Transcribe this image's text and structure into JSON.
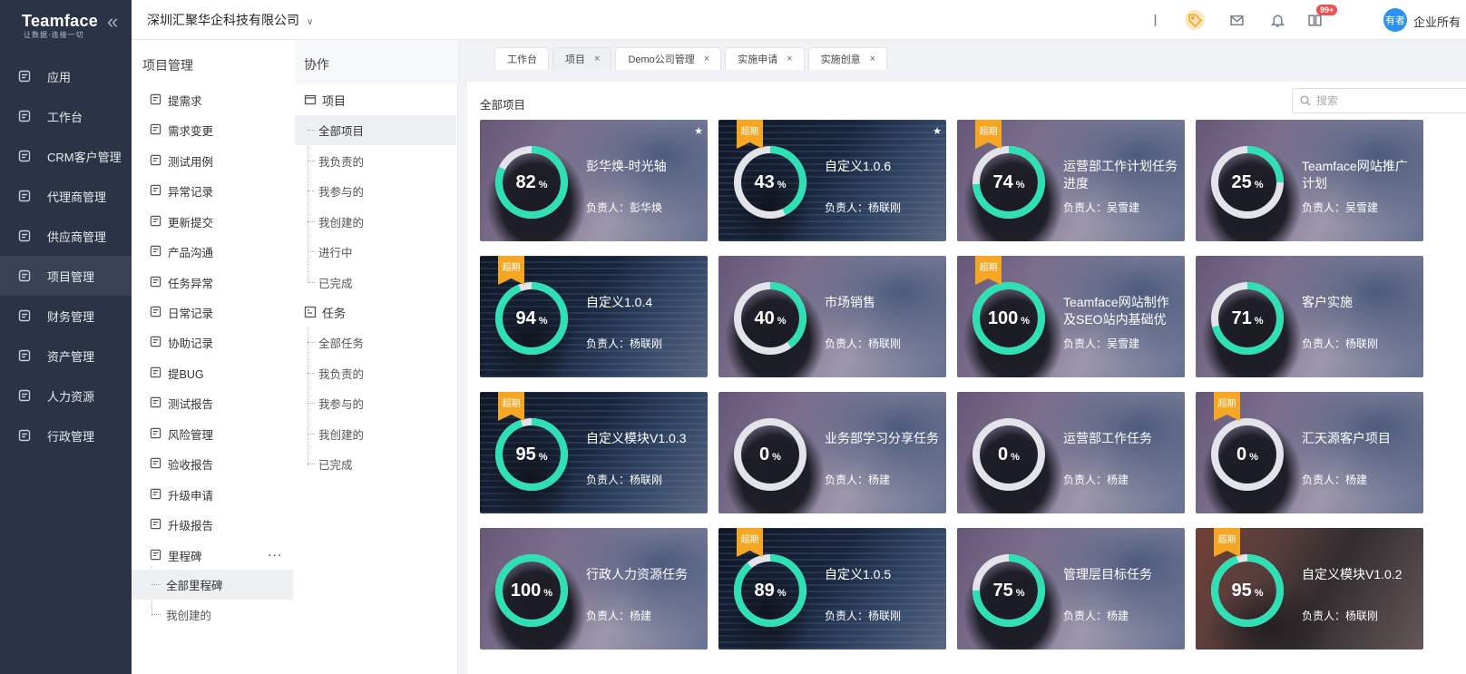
{
  "brand": {
    "logo": "Teamface",
    "slogan": "让数据·连接一切"
  },
  "nav": {
    "items": [
      {
        "label": "应用",
        "icon": "apps-icon",
        "active": false
      },
      {
        "label": "工作台",
        "icon": "dashboard-icon",
        "active": false
      },
      {
        "label": "CRM客户管理",
        "icon": "crm-icon",
        "active": false
      },
      {
        "label": "代理商管理",
        "icon": "agent-icon",
        "active": false
      },
      {
        "label": "供应商管理",
        "icon": "supplier-icon",
        "active": false
      },
      {
        "label": "项目管理",
        "icon": "project-icon",
        "active": true
      },
      {
        "label": "财务管理",
        "icon": "finance-icon",
        "active": false
      },
      {
        "label": "资产管理",
        "icon": "asset-icon",
        "active": false
      },
      {
        "label": "人力资源",
        "icon": "hr-icon",
        "active": false
      },
      {
        "label": "行政管理",
        "icon": "admin-icon",
        "active": false
      }
    ]
  },
  "header": {
    "company": "深圳汇聚华企科技有限公司",
    "notification_count": "99+",
    "avatar_text": "有者",
    "user_label": "企业所有"
  },
  "module": {
    "title": "项目管理",
    "items": [
      {
        "label": "提需求",
        "icon": "requirement-icon"
      },
      {
        "label": "需求变更",
        "icon": "change-icon"
      },
      {
        "label": "测试用例",
        "icon": "testcase-icon"
      },
      {
        "label": "异常记录",
        "icon": "anomaly-icon"
      },
      {
        "label": "更新提交",
        "icon": "update-icon"
      },
      {
        "label": "产品沟通",
        "icon": "communication-icon"
      },
      {
        "label": "任务异常",
        "icon": "task-anomaly-icon"
      },
      {
        "label": "日常记录",
        "icon": "daily-icon"
      },
      {
        "label": "协助记录",
        "icon": "assist-icon"
      },
      {
        "label": "提BUG",
        "icon": "bug-icon"
      },
      {
        "label": "测试报告",
        "icon": "report-icon"
      },
      {
        "label": "风险管理",
        "icon": "risk-icon"
      },
      {
        "label": "验收报告",
        "icon": "acceptance-icon"
      },
      {
        "label": "升级申请",
        "icon": "upgrade-request-icon"
      },
      {
        "label": "升级报告",
        "icon": "upgrade-report-icon"
      },
      {
        "label": "里程碑",
        "icon": "milestone-icon"
      }
    ],
    "milestone_children": [
      {
        "label": "全部里程碑",
        "active": true
      },
      {
        "label": "我创建的",
        "active": false
      }
    ],
    "more": "..."
  },
  "collab": {
    "title": "协作",
    "project_group": "项目",
    "project_items": [
      {
        "label": "全部项目",
        "active": true
      },
      {
        "label": "我负责的",
        "active": false
      },
      {
        "label": "我参与的",
        "active": false
      },
      {
        "label": "我创建的",
        "active": false
      },
      {
        "label": "进行中",
        "active": false
      },
      {
        "label": "已完成",
        "active": false
      }
    ],
    "task_group": "任务",
    "task_items": [
      {
        "label": "全部任务"
      },
      {
        "label": "我负责的"
      },
      {
        "label": "我参与的"
      },
      {
        "label": "我创建的"
      },
      {
        "label": "已完成"
      }
    ]
  },
  "tabs": [
    {
      "label": "工作台",
      "closable": false,
      "active": false
    },
    {
      "label": "项目",
      "closable": true,
      "active": true
    },
    {
      "label": "Demo公司管理",
      "closable": true,
      "active": false
    },
    {
      "label": "实施申请",
      "closable": true,
      "active": false
    },
    {
      "label": "实施创意",
      "closable": true,
      "active": false
    }
  ],
  "panel": {
    "title": "全部项目",
    "search_placeholder": "搜索"
  },
  "colors": {
    "ring": "#2fe0b5",
    "ring_track": "#e3e4ea",
    "overdue": "#f5a623",
    "nav_bg": "#2b3446"
  },
  "overdue_label": "超期",
  "owner_prefix": "负责人：",
  "projects": [
    {
      "name": "彭华焕-时光轴",
      "owner": "彭华焕",
      "progress": 82,
      "overdue": false,
      "starred": true,
      "bg": "coffee"
    },
    {
      "name": "自定义1.0.6",
      "owner": "杨联刚",
      "progress": 43,
      "overdue": true,
      "starred": true,
      "bg": "code"
    },
    {
      "name": "运营部工作计划任务进度",
      "owner": "吴雪建",
      "progress": 74,
      "overdue": true,
      "starred": false,
      "bg": "coffee"
    },
    {
      "name": "Teamface网站推广计划",
      "owner": "吴雪建",
      "progress": 25,
      "overdue": false,
      "starred": false,
      "bg": "coffee"
    },
    {
      "name": "自定义1.0.4",
      "owner": "杨联刚",
      "progress": 94,
      "overdue": true,
      "starred": false,
      "bg": "code"
    },
    {
      "name": "市场销售",
      "owner": "杨联刚",
      "progress": 40,
      "overdue": false,
      "starred": false,
      "bg": "coffee"
    },
    {
      "name": "Teamface网站制作及SEO站内基础优",
      "owner": "吴雪建",
      "progress": 100,
      "overdue": true,
      "starred": false,
      "bg": "coffee"
    },
    {
      "name": "客户实施",
      "owner": "杨联刚",
      "progress": 71,
      "overdue": false,
      "starred": false,
      "bg": "coffee"
    },
    {
      "name": "自定义模块V1.0.3",
      "owner": "杨联刚",
      "progress": 95,
      "overdue": true,
      "starred": false,
      "bg": "code"
    },
    {
      "name": "业务部学习分享任务",
      "owner": "杨建",
      "progress": 0,
      "overdue": false,
      "starred": false,
      "bg": "coffee"
    },
    {
      "name": "运营部工作任务",
      "owner": "杨建",
      "progress": 0,
      "overdue": false,
      "starred": false,
      "bg": "coffee"
    },
    {
      "name": "汇天源客户项目",
      "owner": "杨建",
      "progress": 0,
      "overdue": true,
      "starred": false,
      "bg": "coffee"
    },
    {
      "name": "行政人力资源任务",
      "owner": "杨建",
      "progress": 100,
      "overdue": false,
      "starred": false,
      "bg": "coffee"
    },
    {
      "name": "自定义1.0.5",
      "owner": "杨联刚",
      "progress": 89,
      "overdue": true,
      "starred": false,
      "bg": "code"
    },
    {
      "name": "管理层目标任务",
      "owner": "杨建",
      "progress": 75,
      "overdue": false,
      "starred": false,
      "bg": "coffee"
    },
    {
      "name": "自定义模块V1.0.2",
      "owner": "杨联刚",
      "progress": 95,
      "overdue": true,
      "starred": false,
      "bg": "warm"
    }
  ]
}
